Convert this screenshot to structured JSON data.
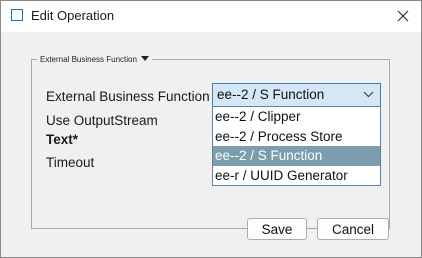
{
  "window": {
    "title": "Edit Operation"
  },
  "group": {
    "legend": "External Business Function"
  },
  "form": {
    "function_label": "External Business Function",
    "output_stream_label": "Use OutputStream",
    "text_label": "Text*",
    "timeout_label": "Timeout"
  },
  "combo": {
    "selected": "ee--2 / S Function",
    "options": [
      "ee--2 / Clipper",
      "ee--2 / Process Store",
      "ee--2 / S Function",
      "ee-r / UUID Generator"
    ],
    "selected_index": 2
  },
  "buttons": {
    "save": "Save",
    "cancel": "Cancel"
  },
  "colors": {
    "accent": "#1f6fb2",
    "combo_fill": "#d5e6f6",
    "selected_item": "#7b9dae"
  },
  "icons": {
    "app": "window-icon",
    "close": "close-icon",
    "legend": "caret-down-icon",
    "combo": "chevron-down-icon"
  }
}
